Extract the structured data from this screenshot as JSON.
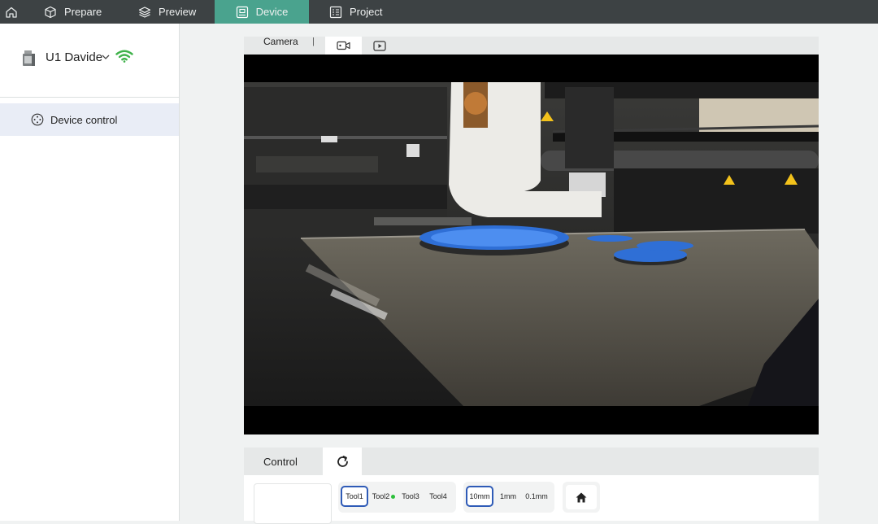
{
  "topbar": {
    "tabs": [
      {
        "label": "Prepare"
      },
      {
        "label": "Preview"
      },
      {
        "label": "Device"
      },
      {
        "label": "Project"
      }
    ],
    "active_color": "#4aa38e"
  },
  "sidebar": {
    "device_name": "U1 Davide",
    "wifi_color": "#3fb24a",
    "nav": [
      {
        "label": "Device control"
      }
    ]
  },
  "camera": {
    "label": "Camera",
    "separator": "|"
  },
  "control": {
    "label": "Control",
    "tools": [
      {
        "label": "Tool1",
        "selected": true
      },
      {
        "label": "Tool2",
        "active_dot": true
      },
      {
        "label": "Tool3"
      },
      {
        "label": "Tool4"
      }
    ],
    "steps": [
      {
        "label": "10mm",
        "selected": true
      },
      {
        "label": "1mm"
      },
      {
        "label": "0.1mm"
      }
    ],
    "accent": "#2f5bb7"
  }
}
